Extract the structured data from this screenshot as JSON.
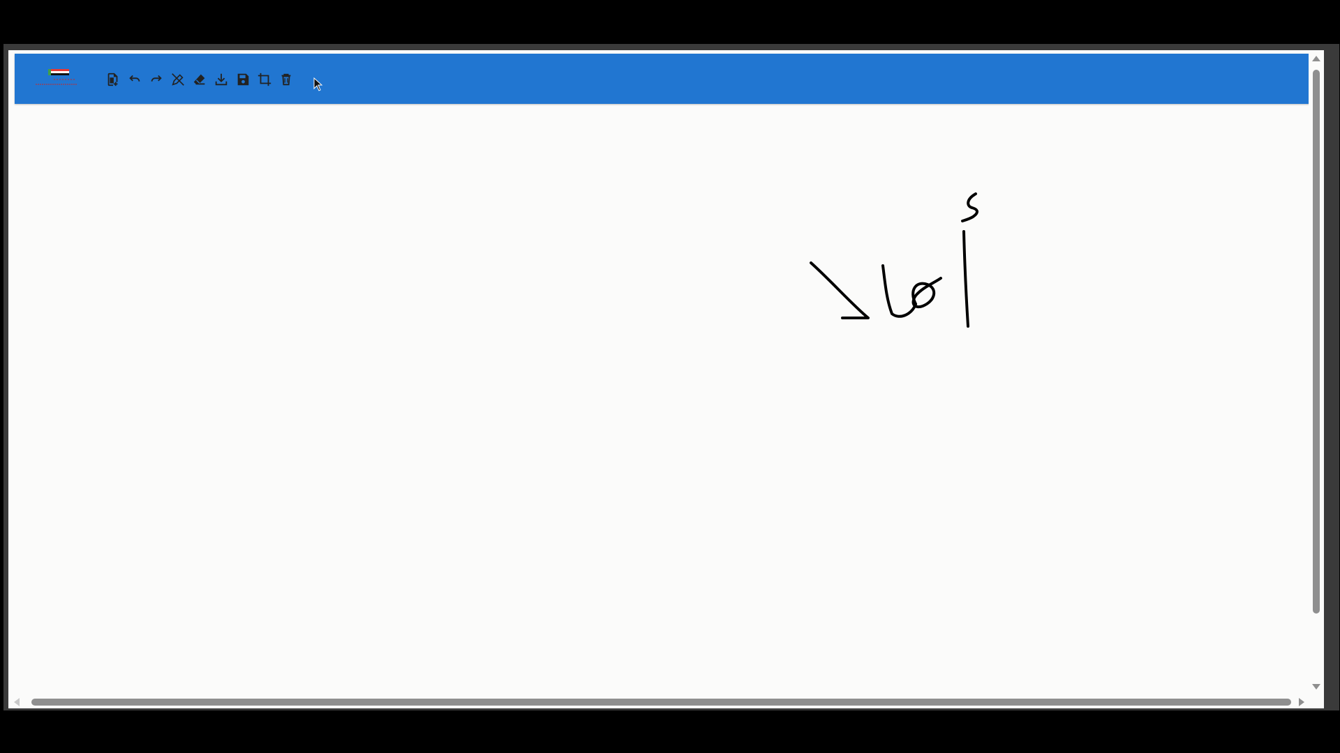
{
  "app": {
    "accent_color": "#2176d1",
    "canvas_color": "#fbfbfa"
  },
  "toolbar": {
    "logo": "app-logo",
    "tools": [
      {
        "name": "new-document",
        "icon": "new-document-icon"
      },
      {
        "name": "undo",
        "icon": "undo-icon"
      },
      {
        "name": "redo",
        "icon": "redo-icon"
      },
      {
        "name": "pen-off",
        "icon": "pen-off-icon"
      },
      {
        "name": "eraser",
        "icon": "eraser-icon"
      },
      {
        "name": "download",
        "icon": "download-icon"
      },
      {
        "name": "save",
        "icon": "save-icon"
      },
      {
        "name": "crop",
        "icon": "crop-icon"
      },
      {
        "name": "delete",
        "icon": "trash-icon"
      }
    ]
  },
  "canvas": {
    "handwriting": "أهلا",
    "ink_color": "#000000"
  }
}
